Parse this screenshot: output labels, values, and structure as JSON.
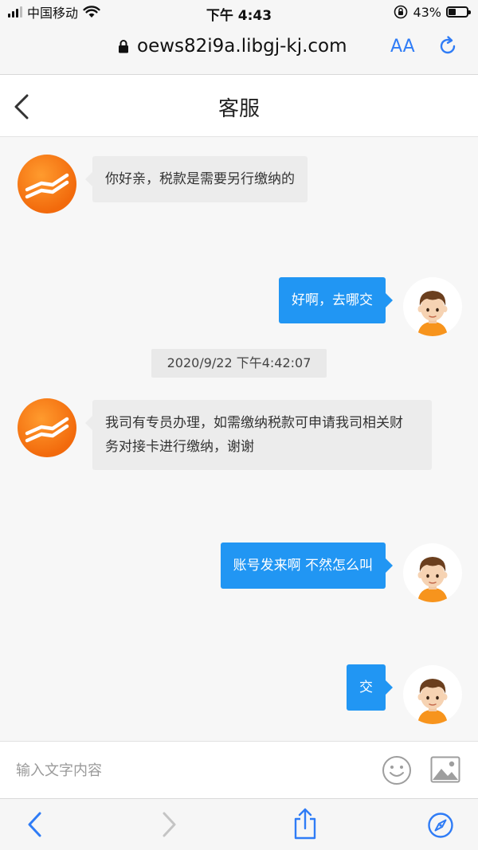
{
  "status_bar": {
    "carrier": "中国移动",
    "time": "下午 4:43",
    "battery": "43%",
    "battery_level": 0.43
  },
  "browser": {
    "url": "oews82i9a.libgj-kj.com",
    "text_size_label": "AA"
  },
  "header": {
    "title": "客服"
  },
  "messages": [
    {
      "from": "agent",
      "text": "你好亲，税款是需要另行缴纳的"
    },
    {
      "from": "user",
      "text": "好啊，去哪交"
    },
    {
      "type": "timestamp",
      "text": "2020/9/22 下午4:42:07"
    },
    {
      "from": "agent",
      "lines": [
        "我司有专员办理，如需缴纳税款可申请我司相关财",
        "务对接卡进行缴纳，谢谢"
      ]
    },
    {
      "from": "user",
      "text": "账号发来啊 不然怎么叫"
    },
    {
      "from": "user",
      "text": "交"
    }
  ],
  "input": {
    "placeholder": "输入文字内容",
    "value": ""
  },
  "icons": {
    "agent_avatar": "trend-logo-icon",
    "user_avatar": "boy-avatar-icon",
    "emoji": "smiley-icon",
    "image": "image-icon",
    "back": "chevron-left-icon",
    "forward": "chevron-right-icon",
    "share": "share-icon",
    "bookmarks": "compass-icon"
  },
  "colors": {
    "accent": "#2196f3",
    "agent_avatar": "#f26a0c",
    "safari_blue": "#2f7cf6"
  }
}
